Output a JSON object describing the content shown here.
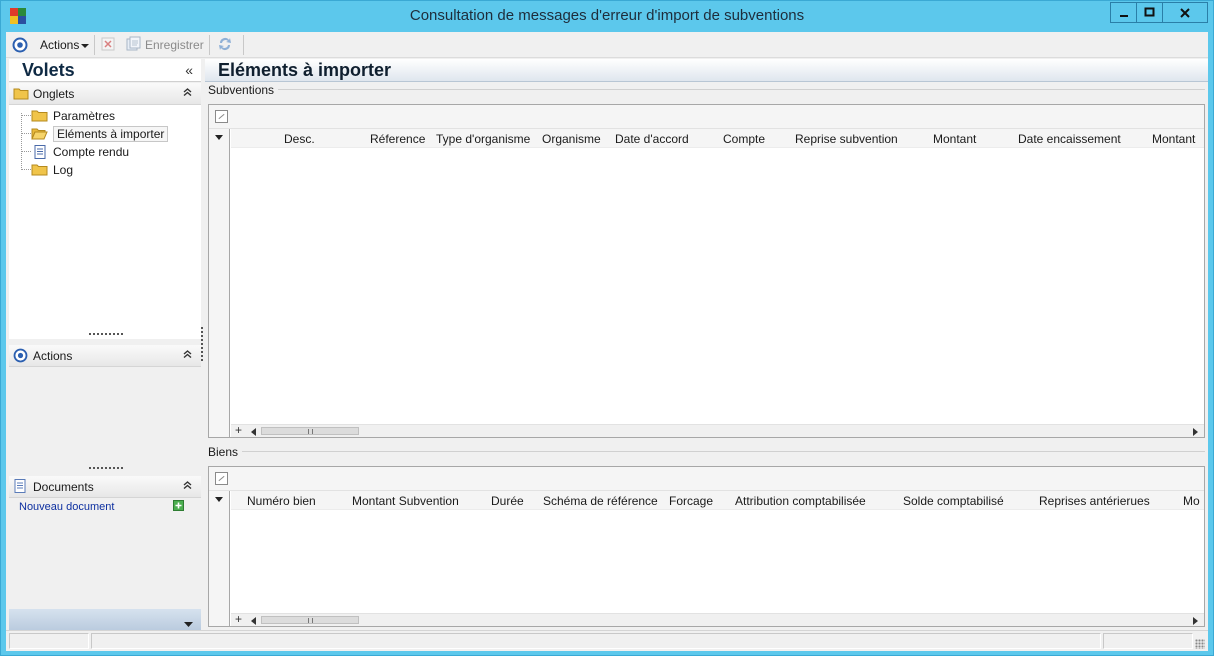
{
  "window": {
    "title": "Consultation de messages d'erreur d'import de subventions",
    "minimize_label": "▬",
    "maximize_label": "□",
    "close_label": "✕"
  },
  "toolbar": {
    "actions_label": "Actions",
    "save_label": "Enregistrer"
  },
  "left_pane": {
    "title": "Volets",
    "collapse_glyph": "«",
    "onglets": {
      "label": "Onglets",
      "items": [
        {
          "label": "Paramètres",
          "icon": "folder-icon"
        },
        {
          "label": "Eléments à importer",
          "icon": "folder-open-icon",
          "selected": true
        },
        {
          "label": "Compte rendu",
          "icon": "document-icon"
        },
        {
          "label": "Log",
          "icon": "folder-icon"
        }
      ]
    },
    "actions": {
      "label": "Actions"
    },
    "documents": {
      "label": "Documents",
      "new_document": "Nouveau document"
    }
  },
  "main": {
    "title": "Eléments à importer",
    "subventions": {
      "label": "Subventions",
      "columns": [
        "Desc.",
        "Réference",
        "Type d'organisme",
        "Organisme",
        "Date d'accord",
        "Compte",
        "Reprise subvention",
        "Montant",
        "Date encaissement",
        "Montant"
      ]
    },
    "biens": {
      "label": "Biens",
      "columns": [
        "Numéro bien",
        "Montant Subvention",
        "Durée",
        "Schéma de référence",
        "Forcage",
        "Attribution comptabilisée",
        "Solde comptabilisé",
        "Reprises antérierues",
        "Mo"
      ]
    }
  },
  "colors": {
    "title_bar": "#5cc8ec",
    "header_gradient_end": "#dfe6ee",
    "link": "#0d2fa0"
  }
}
